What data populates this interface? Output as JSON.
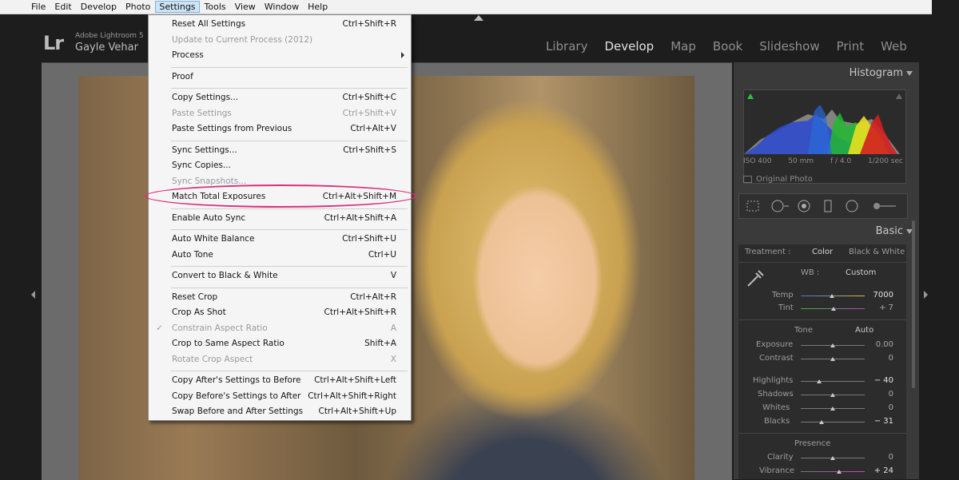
{
  "menubar": {
    "items": [
      "File",
      "Edit",
      "Develop",
      "Photo",
      "Settings",
      "Tools",
      "View",
      "Window",
      "Help"
    ],
    "active": "Settings"
  },
  "identity": {
    "logo": "Lr",
    "app_name": "Adobe Lightroom 5",
    "user": "Gayle Vehar"
  },
  "modules": {
    "items": [
      "Library",
      "Develop",
      "Map",
      "Book",
      "Slideshow",
      "Print",
      "Web"
    ],
    "active": "Develop"
  },
  "settings_menu": {
    "items": [
      {
        "label": "Reset All Settings",
        "shortcut": "Ctrl+Shift+R",
        "enabled": true
      },
      {
        "label": "Update to Current Process (2012)",
        "shortcut": "",
        "enabled": false
      },
      {
        "label": "Process",
        "shortcut": "",
        "enabled": true,
        "submenu": true
      },
      {
        "separator": true
      },
      {
        "label": "Proof",
        "shortcut": "",
        "enabled": true
      },
      {
        "separator": true
      },
      {
        "label": "Copy Settings...",
        "shortcut": "Ctrl+Shift+C",
        "enabled": true
      },
      {
        "label": "Paste Settings",
        "shortcut": "Ctrl+Shift+V",
        "enabled": false
      },
      {
        "label": "Paste Settings from Previous",
        "shortcut": "Ctrl+Alt+V",
        "enabled": true
      },
      {
        "separator": true
      },
      {
        "label": "Sync Settings...",
        "shortcut": "Ctrl+Shift+S",
        "enabled": true
      },
      {
        "label": "Sync Copies...",
        "shortcut": "",
        "enabled": true
      },
      {
        "label": "Sync Snapshots...",
        "shortcut": "",
        "enabled": false
      },
      {
        "label": "Match Total Exposures",
        "shortcut": "Ctrl+Alt+Shift+M",
        "enabled": true,
        "highlighted": true
      },
      {
        "separator": true
      },
      {
        "label": "Enable Auto Sync",
        "shortcut": "Ctrl+Alt+Shift+A",
        "enabled": true
      },
      {
        "separator": true
      },
      {
        "label": "Auto White Balance",
        "shortcut": "Ctrl+Shift+U",
        "enabled": true
      },
      {
        "label": "Auto Tone",
        "shortcut": "Ctrl+U",
        "enabled": true
      },
      {
        "separator": true
      },
      {
        "label": "Convert to Black & White",
        "shortcut": "V",
        "enabled": true
      },
      {
        "separator": true
      },
      {
        "label": "Reset Crop",
        "shortcut": "Ctrl+Alt+R",
        "enabled": true
      },
      {
        "label": "Crop As Shot",
        "shortcut": "Ctrl+Alt+Shift+R",
        "enabled": true
      },
      {
        "label": "Constrain Aspect Ratio",
        "shortcut": "A",
        "enabled": false,
        "checked": true
      },
      {
        "label": "Crop to Same Aspect Ratio",
        "shortcut": "Shift+A",
        "enabled": true
      },
      {
        "label": "Rotate Crop Aspect",
        "shortcut": "X",
        "enabled": false
      },
      {
        "separator": true
      },
      {
        "label": "Copy After's Settings to Before",
        "shortcut": "Ctrl+Alt+Shift+Left",
        "enabled": true
      },
      {
        "label": "Copy Before's Settings to After",
        "shortcut": "Ctrl+Alt+Shift+Right",
        "enabled": true
      },
      {
        "label": "Swap Before and After Settings",
        "shortcut": "Ctrl+Alt+Shift+Up",
        "enabled": true
      }
    ]
  },
  "histogram": {
    "title": "Histogram",
    "iso": "ISO 400",
    "focal": "50 mm",
    "aperture": "f / 4.0",
    "shutter": "1/200 sec",
    "original_photo": "Original Photo"
  },
  "basic": {
    "title": "Basic",
    "treatment_label": "Treatment :",
    "treatment_color": "Color",
    "treatment_bw": "Black & White",
    "wb_label": "WB :",
    "wb_value": "Custom",
    "temp_label": "Temp",
    "temp_value": "7000",
    "tint_label": "Tint",
    "tint_value": "+ 7",
    "tone_label": "Tone",
    "auto_label": "Auto",
    "exposure_label": "Exposure",
    "exposure_value": "0.00",
    "contrast_label": "Contrast",
    "contrast_value": "0",
    "highlights_label": "Highlights",
    "highlights_value": "− 40",
    "shadows_label": "Shadows",
    "shadows_value": "0",
    "whites_label": "Whites",
    "whites_value": "0",
    "blacks_label": "Blacks",
    "blacks_value": "− 31",
    "presence_label": "Presence",
    "clarity_label": "Clarity",
    "clarity_value": "0",
    "vibrance_label": "Vibrance",
    "vibrance_value": "+ 24"
  }
}
